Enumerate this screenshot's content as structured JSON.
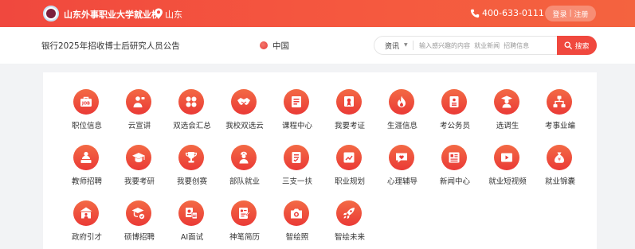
{
  "header": {
    "site_name": "山东外事职业大学就业桥",
    "location": "山东",
    "phone": "400-633-0111",
    "login": "登录",
    "login_sep": "|",
    "register": "注册"
  },
  "search": {
    "notice": "银行2025年招收博士后研究人员公告",
    "region": "中国",
    "category": "资讯",
    "placeholder": "输入感兴趣的内容  就业新闻  招聘信息",
    "button": "搜索"
  },
  "menu": [
    [
      {
        "label": "职位信息",
        "icon": "job-bag-icon"
      },
      {
        "label": "云宣讲",
        "icon": "presenter-icon"
      },
      {
        "label": "双选会汇总",
        "icon": "grid-icon"
      },
      {
        "label": "我校双选云",
        "icon": "handshake-icon"
      },
      {
        "label": "课程中心",
        "icon": "book-icon"
      },
      {
        "label": "我要考证",
        "icon": "certificate-icon"
      },
      {
        "label": "生涯信息",
        "icon": "flame-icon"
      },
      {
        "label": "考公务员",
        "icon": "document-icon"
      },
      {
        "label": "选调生",
        "icon": "graduate-icon"
      },
      {
        "label": "考事业编",
        "icon": "org-chart-icon"
      }
    ],
    [
      {
        "label": "教师招聘",
        "icon": "teacher-icon"
      },
      {
        "label": "我要考研",
        "icon": "grad-cap-icon"
      },
      {
        "label": "我要创赛",
        "icon": "trophy-icon"
      },
      {
        "label": "部队就业",
        "icon": "soldier-icon"
      },
      {
        "label": "三支一扶",
        "icon": "checklist-icon"
      },
      {
        "label": "职业规划",
        "icon": "chart-board-icon"
      },
      {
        "label": "心理辅导",
        "icon": "heart-chat-icon"
      },
      {
        "label": "新闻中心",
        "icon": "newspaper-icon"
      },
      {
        "label": "就业短视频",
        "icon": "video-play-icon"
      },
      {
        "label": "就业锦囊",
        "icon": "money-bag-icon"
      }
    ],
    [
      {
        "label": "政府引才",
        "icon": "government-icon"
      },
      {
        "label": "硕博招聘",
        "icon": "doctor-cap-icon"
      },
      {
        "label": "AI面试",
        "icon": "ai-interview-icon"
      },
      {
        "label": "神笔简历",
        "icon": "resume-icon"
      },
      {
        "label": "智绘照",
        "icon": "camera-icon"
      },
      {
        "label": "智绘未来",
        "icon": "rocket-icon"
      }
    ]
  ],
  "colors": {
    "accent": "#f0483e",
    "icon_gradient_top": "#f36a45",
    "icon_gradient_bottom": "#ea3a36"
  }
}
